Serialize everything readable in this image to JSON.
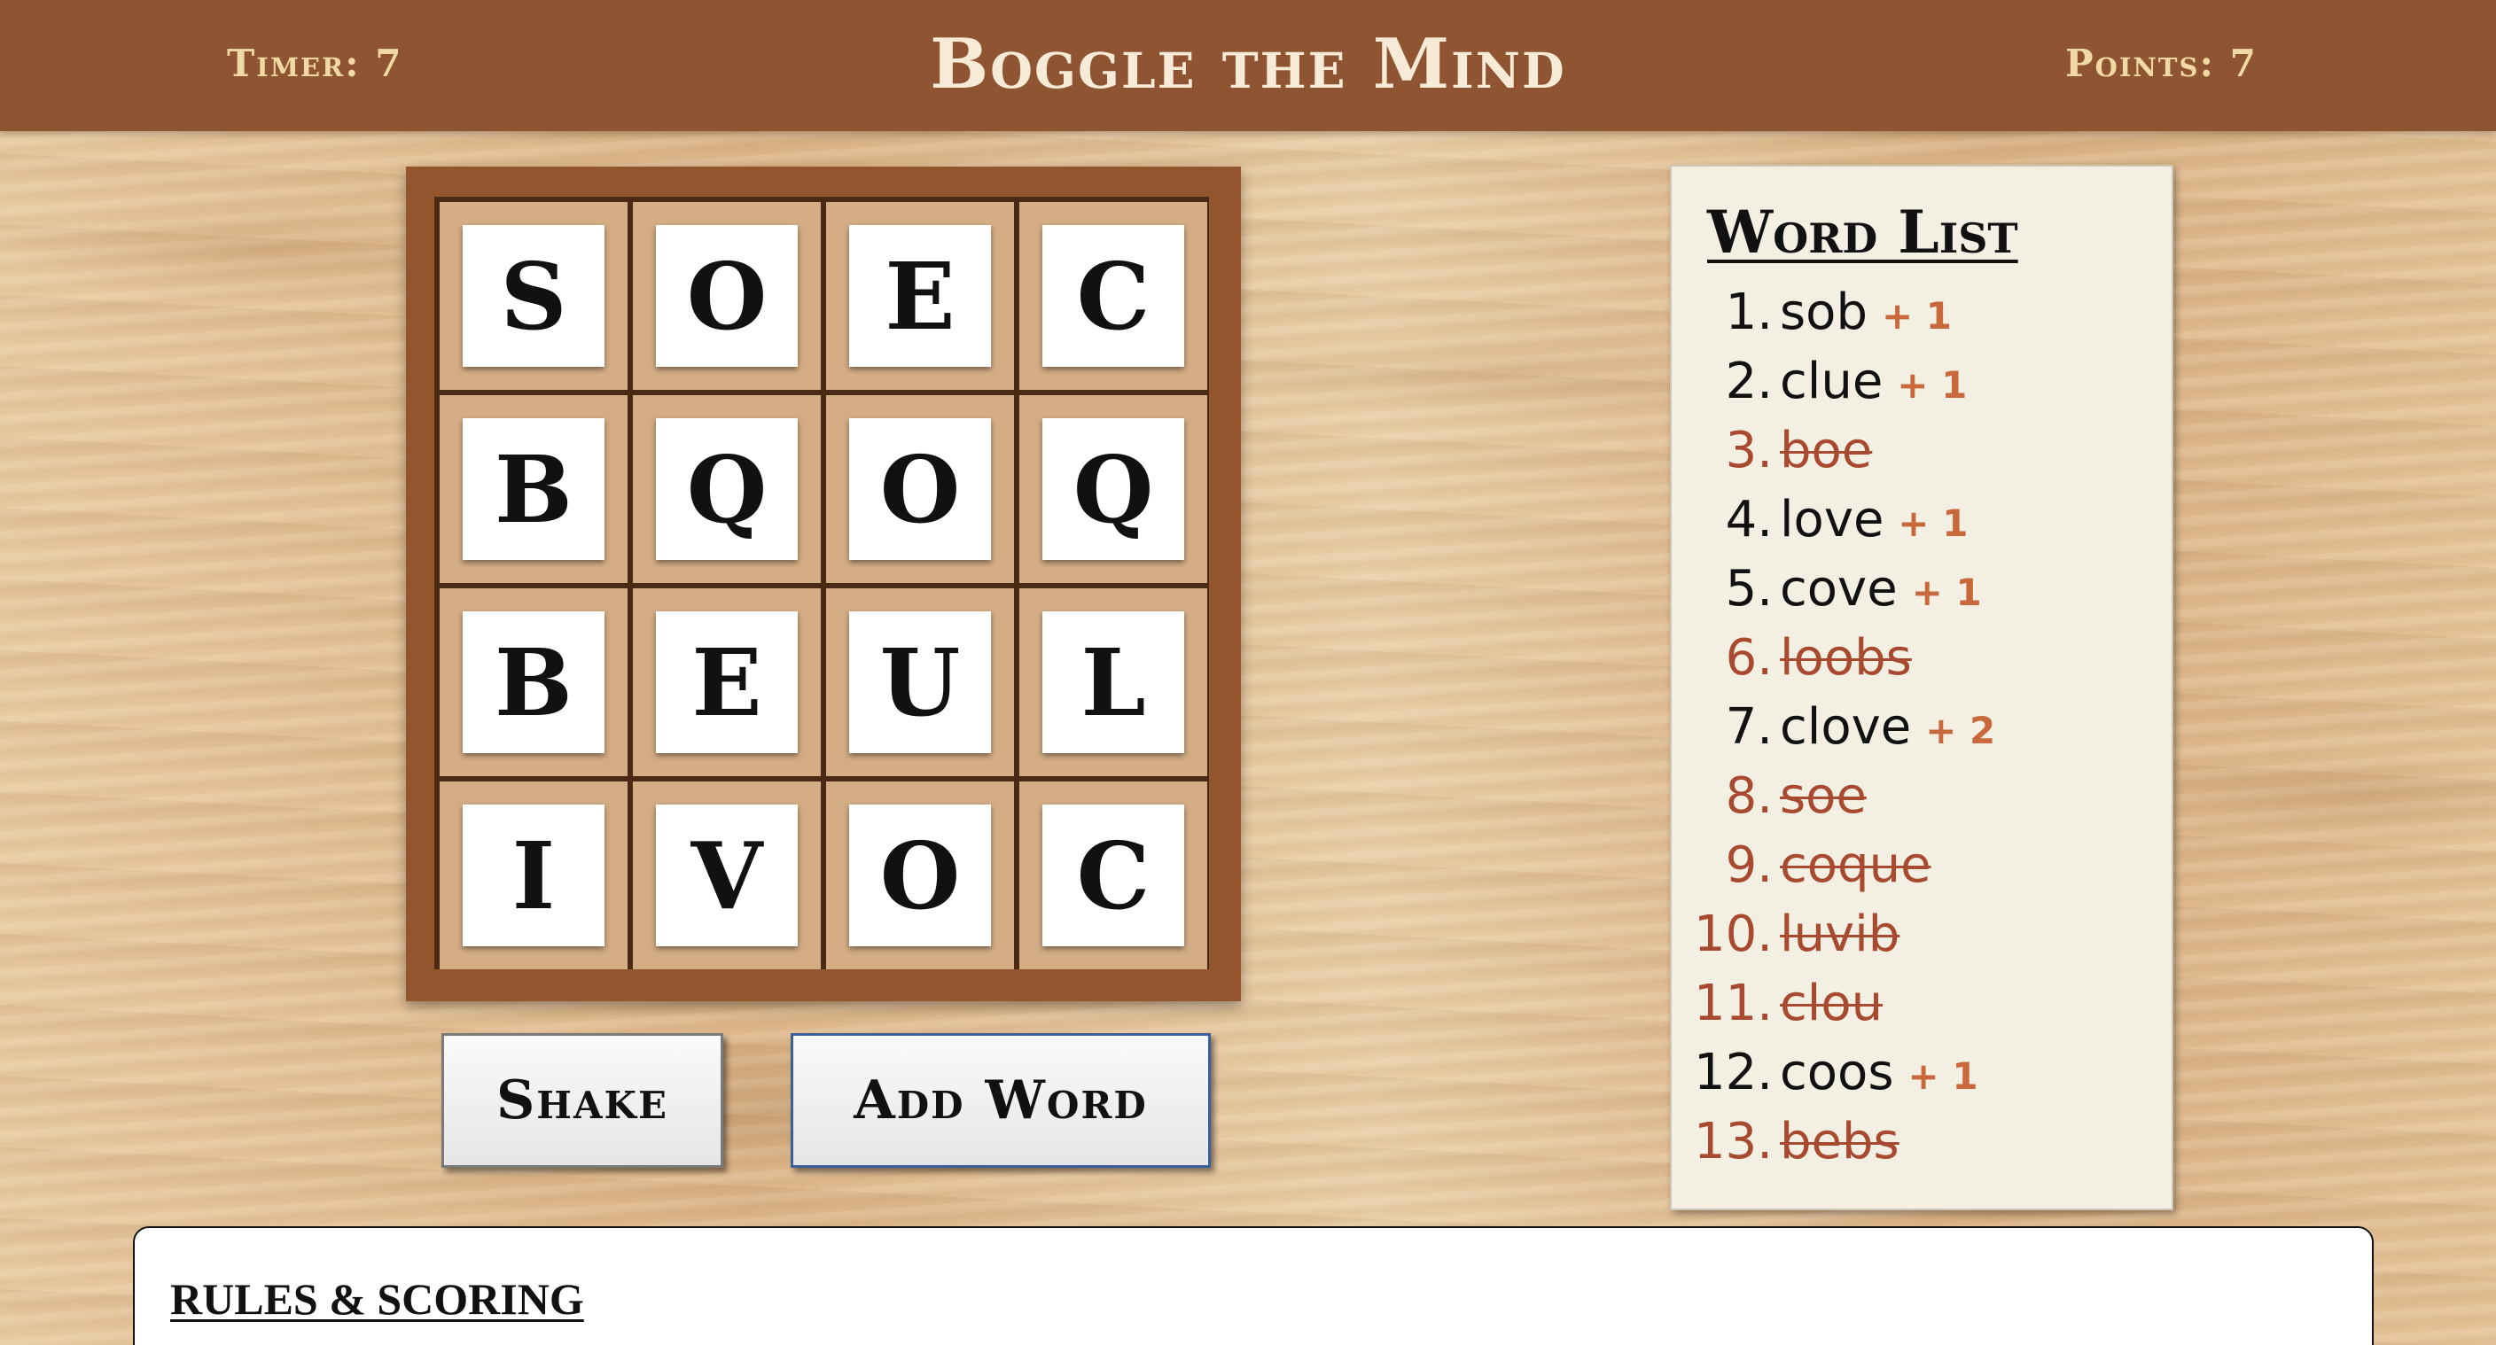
{
  "header": {
    "timer_label": "Timer: 7",
    "title": "Boggle the Mind",
    "points_label": "Points: 7"
  },
  "board": {
    "rows": [
      [
        "S",
        "O",
        "E",
        "C"
      ],
      [
        "B",
        "Q",
        "O",
        "Q"
      ],
      [
        "B",
        "E",
        "U",
        "L"
      ],
      [
        "I",
        "V",
        "O",
        "C"
      ]
    ]
  },
  "buttons": {
    "shake_label": "Shake",
    "add_word_label": "Add Word"
  },
  "word_list": {
    "title": "Word List",
    "words": [
      {
        "num": "1.",
        "word": "sob",
        "points": "+ 1",
        "valid": true
      },
      {
        "num": "2.",
        "word": "clue",
        "points": "+ 1",
        "valid": true
      },
      {
        "num": "3.",
        "word": "boe",
        "points": "",
        "valid": false
      },
      {
        "num": "4.",
        "word": "love",
        "points": "+ 1",
        "valid": true
      },
      {
        "num": "5.",
        "word": "cove",
        "points": "+ 1",
        "valid": true
      },
      {
        "num": "6.",
        "word": "loobs",
        "points": "",
        "valid": false
      },
      {
        "num": "7.",
        "word": "clove",
        "points": "+ 2",
        "valid": true
      },
      {
        "num": "8.",
        "word": "soe",
        "points": "",
        "valid": false
      },
      {
        "num": "9.",
        "word": "coque",
        "points": "",
        "valid": false
      },
      {
        "num": "10.",
        "word": "luvib",
        "points": "",
        "valid": false
      },
      {
        "num": "11.",
        "word": "clou",
        "points": "",
        "valid": false
      },
      {
        "num": "12.",
        "word": "coos",
        "points": "+ 1",
        "valid": true
      },
      {
        "num": "13.",
        "word": "bebs",
        "points": "",
        "valid": false
      }
    ]
  },
  "rules": {
    "title": "RULES & SCORING"
  },
  "colors": {
    "header_bg": "#8f5533",
    "board_frame": "#93552e",
    "invalid_word": "#a84a30",
    "points_accent": "#c8683b"
  }
}
